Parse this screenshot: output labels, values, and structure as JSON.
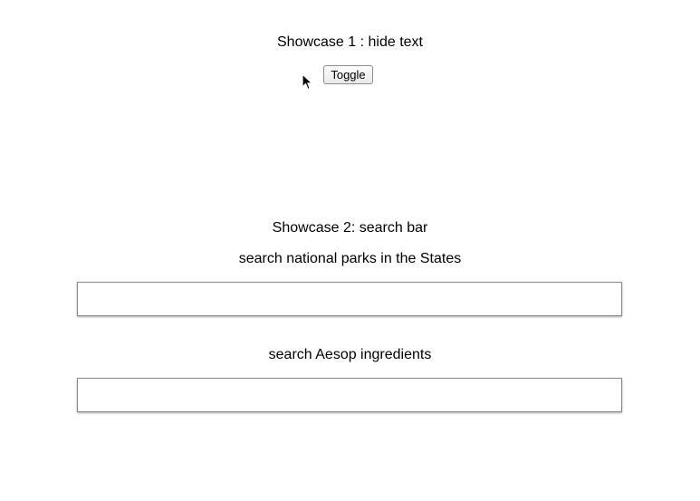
{
  "showcase1": {
    "title": "Showcase 1 : hide text",
    "toggle_label": "Toggle"
  },
  "showcase2": {
    "title": "Showcase 2: search bar",
    "parks": {
      "label": "search national parks in the States",
      "value": "",
      "placeholder": ""
    },
    "aesop": {
      "label": "search Aesop ingredients",
      "value": "",
      "placeholder": ""
    }
  },
  "cursor": {
    "icon": "arrow-pointer-icon"
  }
}
